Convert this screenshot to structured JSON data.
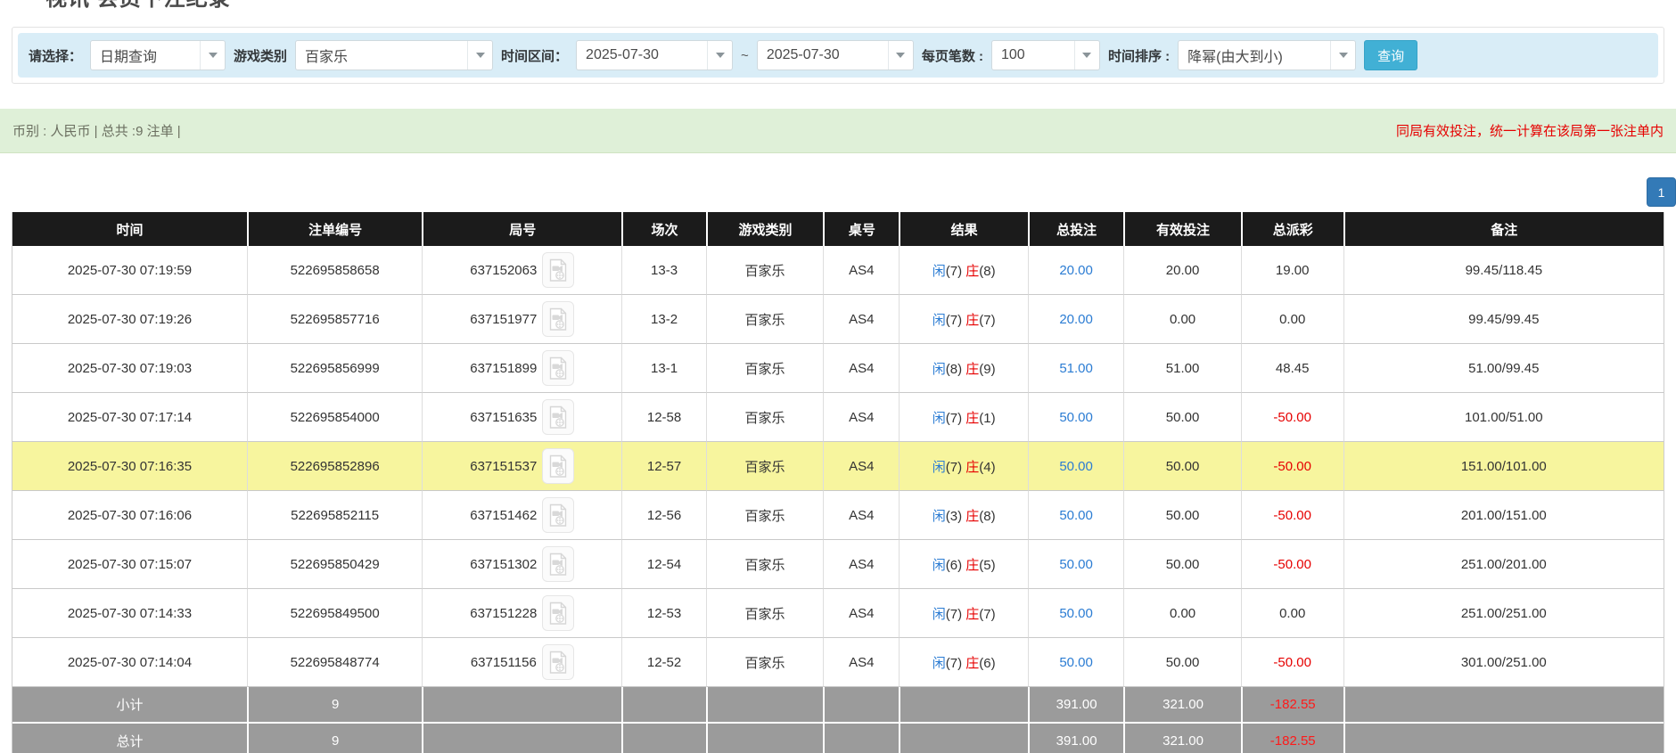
{
  "page": {
    "title": "视讯 会员下注纪录"
  },
  "filters": {
    "select_label": "请选择：",
    "select_value": "日期查询",
    "game_type_label": "游戏类别",
    "game_type_value": "百家乐",
    "date_range_label": "时间区间：",
    "date_from": "2025-07-30",
    "tilde": "~",
    "date_to": "2025-07-30",
    "page_size_label": "每页笔数 :",
    "page_size_value": "100",
    "sort_label": "时间排序 :",
    "sort_value": "降幂(由大到小)",
    "search_button": "查询"
  },
  "summary": {
    "left_text": "币别 : 人民币 | 总共 :9 注单 |",
    "right_note": "同局有效投注，统一计算在该局第一张注单内"
  },
  "pagination": {
    "current_page": "1"
  },
  "colors": {
    "header_bg": "#1b1b1b",
    "highlight_row": "#f7f59e",
    "footer_bg": "#9b9b9b",
    "filter_bg": "#d9edf7",
    "summary_bg": "#dff0d8",
    "accent_blue": "#2b7cd3",
    "alert_red": "#e60000",
    "search_button_bg": "#41b0d5",
    "pagination_bg": "#337ab7"
  },
  "table": {
    "headers": [
      "时间",
      "注单编号",
      "局号",
      "场次",
      "游戏类别",
      "桌号",
      "结果",
      "总投注",
      "有效投注",
      "总派彩",
      "备注"
    ],
    "result_labels": {
      "player": "闲",
      "banker": "庄"
    },
    "video_icon": "video-file-icon",
    "rows": [
      {
        "time": "2025-07-30 07:19:59",
        "bet_id": "522695858658",
        "round_id": "637152063",
        "session": "13-3",
        "game": "百家乐",
        "table_no": "AS4",
        "player": "7",
        "banker": "8",
        "total_bet": "20.00",
        "valid_bet": "20.00",
        "payout": "19.00",
        "note": "99.45/118.45",
        "highlighted": false
      },
      {
        "time": "2025-07-30 07:19:26",
        "bet_id": "522695857716",
        "round_id": "637151977",
        "session": "13-2",
        "game": "百家乐",
        "table_no": "AS4",
        "player": "7",
        "banker": "7",
        "total_bet": "20.00",
        "valid_bet": "0.00",
        "payout": "0.00",
        "note": "99.45/99.45",
        "highlighted": false
      },
      {
        "time": "2025-07-30 07:19:03",
        "bet_id": "522695856999",
        "round_id": "637151899",
        "session": "13-1",
        "game": "百家乐",
        "table_no": "AS4",
        "player": "8",
        "banker": "9",
        "total_bet": "51.00",
        "valid_bet": "51.00",
        "payout": "48.45",
        "note": "51.00/99.45",
        "highlighted": false
      },
      {
        "time": "2025-07-30 07:17:14",
        "bet_id": "522695854000",
        "round_id": "637151635",
        "session": "12-58",
        "game": "百家乐",
        "table_no": "AS4",
        "player": "7",
        "banker": "1",
        "total_bet": "50.00",
        "valid_bet": "50.00",
        "payout": "-50.00",
        "note": "101.00/51.00",
        "highlighted": false
      },
      {
        "time": "2025-07-30 07:16:35",
        "bet_id": "522695852896",
        "round_id": "637151537",
        "session": "12-57",
        "game": "百家乐",
        "table_no": "AS4",
        "player": "7",
        "banker": "4",
        "total_bet": "50.00",
        "valid_bet": "50.00",
        "payout": "-50.00",
        "note": "151.00/101.00",
        "highlighted": true
      },
      {
        "time": "2025-07-30 07:16:06",
        "bet_id": "522695852115",
        "round_id": "637151462",
        "session": "12-56",
        "game": "百家乐",
        "table_no": "AS4",
        "player": "3",
        "banker": "8",
        "total_bet": "50.00",
        "valid_bet": "50.00",
        "payout": "-50.00",
        "note": "201.00/151.00",
        "highlighted": false
      },
      {
        "time": "2025-07-30 07:15:07",
        "bet_id": "522695850429",
        "round_id": "637151302",
        "session": "12-54",
        "game": "百家乐",
        "table_no": "AS4",
        "player": "6",
        "banker": "5",
        "total_bet": "50.00",
        "valid_bet": "50.00",
        "payout": "-50.00",
        "note": "251.00/201.00",
        "highlighted": false
      },
      {
        "time": "2025-07-30 07:14:33",
        "bet_id": "522695849500",
        "round_id": "637151228",
        "session": "12-53",
        "game": "百家乐",
        "table_no": "AS4",
        "player": "7",
        "banker": "7",
        "total_bet": "50.00",
        "valid_bet": "0.00",
        "payout": "0.00",
        "note": "251.00/251.00",
        "highlighted": false
      },
      {
        "time": "2025-07-30 07:14:04",
        "bet_id": "522695848774",
        "round_id": "637151156",
        "session": "12-52",
        "game": "百家乐",
        "table_no": "AS4",
        "player": "7",
        "banker": "6",
        "total_bet": "50.00",
        "valid_bet": "50.00",
        "payout": "-50.00",
        "note": "301.00/251.00",
        "highlighted": false
      }
    ],
    "footer_rows": [
      {
        "label": "小计",
        "count": "9",
        "total_bet": "391.00",
        "valid_bet": "321.00",
        "payout": "-182.55"
      },
      {
        "label": "总计",
        "count": "9",
        "total_bet": "391.00",
        "valid_bet": "321.00",
        "payout": "-182.55"
      }
    ]
  }
}
